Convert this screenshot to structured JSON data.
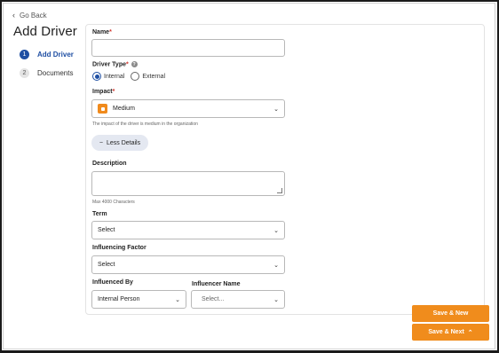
{
  "nav": {
    "go_back": "Go Back"
  },
  "page": {
    "title": "Add Driver"
  },
  "steps": [
    {
      "num": "1",
      "label": "Add Driver",
      "active": true
    },
    {
      "num": "2",
      "label": "Documents",
      "active": false
    }
  ],
  "form": {
    "name_label": "Name",
    "name_value": "",
    "required_mark": "*",
    "driver_type_label": "Driver Type",
    "driver_type_help": "?",
    "driver_type_options": [
      "Internal",
      "External"
    ],
    "driver_type_selected": "Internal",
    "impact_label": "Impact",
    "impact_value": "Medium",
    "impact_color": "#f08a1c",
    "impact_note": "The impact of the driver is medium in the organization",
    "less_details_label": "Less Details",
    "description_label": "Description",
    "description_value": "",
    "description_note": "Max 4000 Characters",
    "term_label": "Term",
    "term_value": "Select",
    "influencing_factor_label": "Influencing Factor",
    "influencing_factor_value": "Select",
    "influenced_by_label": "Influenced By",
    "influenced_by_value": "Internal Person",
    "influencer_name_label": "Influencer Name",
    "influencer_name_placeholder": "Select..."
  },
  "actions": {
    "save_new": "Save & New",
    "save_next": "Save & Next"
  },
  "colors": {
    "accent": "#1f4fa3",
    "button": "#f08c1c",
    "required": "#d0342c"
  }
}
